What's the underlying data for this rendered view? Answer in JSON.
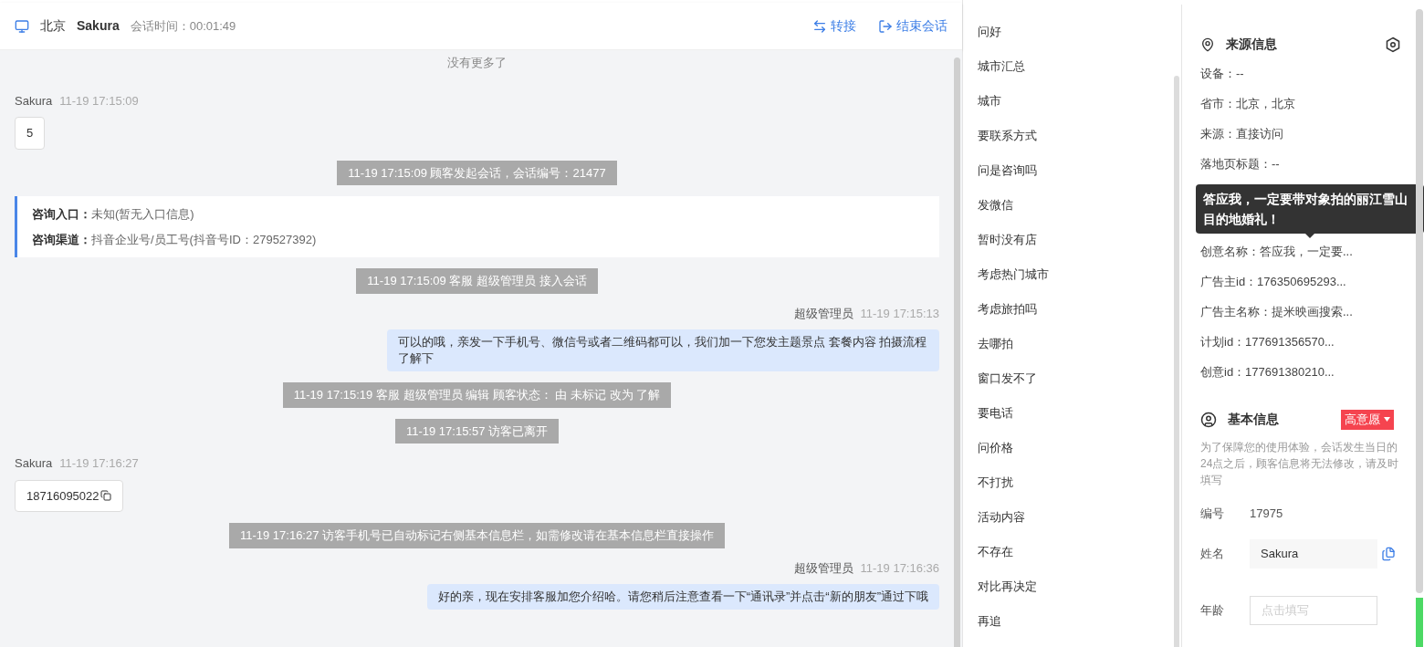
{
  "header": {
    "location": "北京",
    "visitor": "Sakura",
    "duration_label": "会话时间：00:01:49",
    "actions": [
      {
        "label": "转接",
        "kind": "transfer"
      },
      {
        "label": "结束会话",
        "kind": "end"
      }
    ]
  },
  "chat": {
    "no_more": "没有更多了",
    "messages": [
      {
        "kind": "customer",
        "name": "Sakura",
        "time": "11-19 17:15:09",
        "text": "5",
        "copy": false
      },
      {
        "kind": "status",
        "text": "11-19 17:15:09 顾客发起会话，会话编号：21477"
      },
      {
        "kind": "entry",
        "lines": [
          {
            "label": "咨询入口：",
            "value": "未知(暂无入口信息)"
          },
          {
            "label": "咨询渠道：",
            "value": "抖音企业号/员工号(抖音号ID：279527392)"
          }
        ]
      },
      {
        "kind": "status",
        "text": "11-19 17:15:09 客服 超级管理员 接入会话"
      },
      {
        "kind": "agent",
        "name": "超级管理员",
        "time": "11-19 17:15:13",
        "text": "可以的哦，亲发一下手机号、微信号或者二维码都可以，我们加一下您发主题景点 套餐内容 拍摄流程了解下"
      },
      {
        "kind": "status",
        "text": "11-19 17:15:19 客服 超级管理员 编辑 顾客状态： 由 未标记 改为 了解"
      },
      {
        "kind": "status",
        "text": "11-19 17:15:57 访客已离开"
      },
      {
        "kind": "customer",
        "name": "Sakura",
        "time": "11-19 17:16:27",
        "text": "18716095022",
        "copy": true
      },
      {
        "kind": "status",
        "text": "11-19 17:16:27 访客手机号已自动标记右侧基本信息栏，如需修改请在基本信息栏直接操作"
      },
      {
        "kind": "agent",
        "name": "超级管理员",
        "time": "11-19 17:16:36",
        "text": "好的亲，现在安排客服加您介绍哈。请您稍后注意查看一下“通讯录”并点击“新的朋友”通过下哦"
      }
    ]
  },
  "quick_replies": [
    "问好",
    "城市汇总",
    "城市",
    "要联系方式",
    "问是咨询吗",
    "发微信",
    "暂时没有店",
    "考虑热门城市",
    "考虑旅拍吗",
    "去哪拍",
    "窗口发不了",
    "要电话",
    "问价格",
    "不打扰",
    "活动内容",
    "不存在",
    "对比再决定",
    "再追"
  ],
  "source_info": {
    "title": "来源信息",
    "rows": [
      "设备：--",
      "省市：北京，北京",
      "来源：直接访问",
      "落地页标题：--"
    ],
    "tooltip": "答应我，一定要带对象拍的丽江雪山目的地婚礼！",
    "more_rows": [
      "创意名称：答应我，一定要...",
      "广告主id：176350695293...",
      "广告主名称：提米映画搜索...",
      "计划id：177691356570...",
      "创意id：177691380210..."
    ]
  },
  "basic_info": {
    "title": "基本信息",
    "tag": {
      "label": "高意愿",
      "color": "#f5444f"
    },
    "notice": "为了保障您的使用体验，会话发生当日的24点之后，顾客信息将无法修改，请及时填写",
    "fields": [
      {
        "kind": "text",
        "label": "编号",
        "value": "17975"
      },
      {
        "kind": "filled",
        "label": "姓名",
        "value": "Sakura"
      },
      {
        "kind": "input",
        "label": "年龄",
        "placeholder": "点击填写"
      }
    ]
  }
}
